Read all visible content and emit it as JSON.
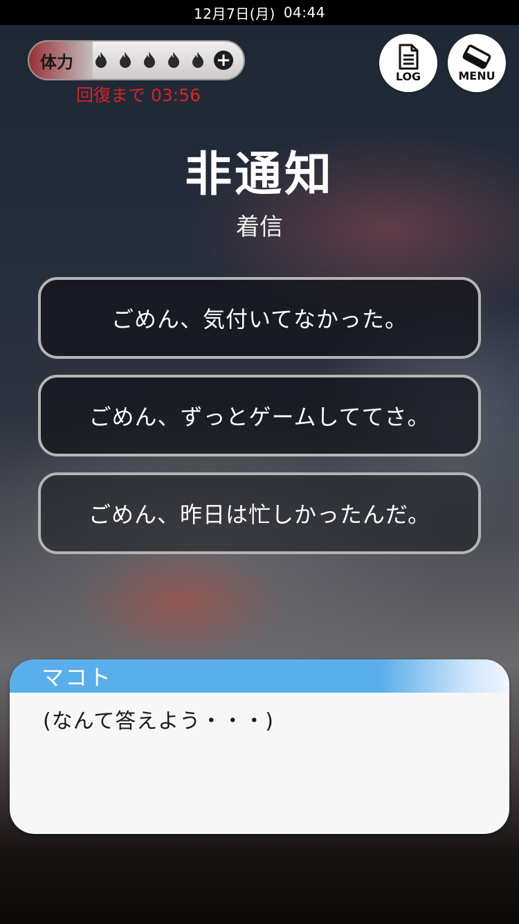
{
  "status_bar": {
    "date": "12月7日(月)",
    "time": "04:44"
  },
  "stamina": {
    "label": "体力",
    "current": 5,
    "max": 5,
    "plus_symbol": "+",
    "recovery_text": "回復まで 03:56"
  },
  "buttons": {
    "log_label": "LOG",
    "menu_label": "MENU"
  },
  "call": {
    "caller": "非通知",
    "status": "着信"
  },
  "choices": [
    {
      "label": "ごめん、気付いてなかった。"
    },
    {
      "label": "ごめん、ずっとゲームしててさ。"
    },
    {
      "label": "ごめん、昨日は忙しかったんだ。"
    }
  ],
  "dialog": {
    "speaker": "マコト",
    "text": "(なんて答えよう・・・)"
  },
  "colors": {
    "recovery_text": "#d9202a",
    "name_bar": "#5aaeea",
    "choice_border": "#b5b5b5"
  }
}
